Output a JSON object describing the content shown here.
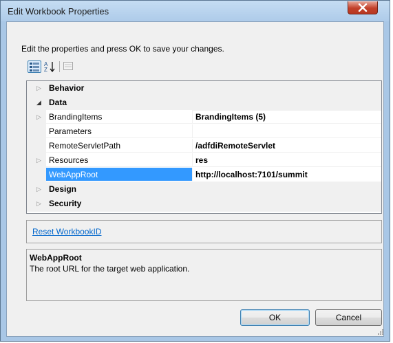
{
  "window": {
    "title": "Edit Workbook Properties",
    "close_symbol": "x"
  },
  "instruction": "Edit the properties and press OK to save your changes.",
  "toolbar": {
    "categorized_icon": "categorized-view-icon",
    "alphabetical_icon": "sort-alphabetical-icon",
    "property_pages_icon": "property-pages-icon"
  },
  "grid": {
    "rows": [
      {
        "kind": "category",
        "label": "Behavior",
        "expander": "▷"
      },
      {
        "kind": "category",
        "label": "Data",
        "expander": "◢"
      },
      {
        "kind": "property",
        "name": "BrandingItems",
        "value": "BrandingItems (5)",
        "expander": "▷"
      },
      {
        "kind": "property",
        "name": "Parameters",
        "value": ""
      },
      {
        "kind": "property",
        "name": "RemoteServletPath",
        "value": "/adfdiRemoteServlet"
      },
      {
        "kind": "property",
        "name": "Resources",
        "value": "res",
        "expander": "▷"
      },
      {
        "kind": "property",
        "name": "WebAppRoot",
        "value": "http://localhost:7101/summit",
        "selected": true
      },
      {
        "kind": "category",
        "label": "Design",
        "expander": "▷"
      },
      {
        "kind": "category",
        "label": "Security",
        "expander": "▷"
      }
    ]
  },
  "commands": {
    "reset_link": "Reset WorkbookID"
  },
  "description": {
    "title": "WebAppRoot",
    "text": "The root URL for the target web application."
  },
  "buttons": {
    "ok": "OK",
    "cancel": "Cancel"
  },
  "colors": {
    "selection": "#3399ff",
    "link": "#0066cc",
    "frame": "#a9c7e6"
  }
}
